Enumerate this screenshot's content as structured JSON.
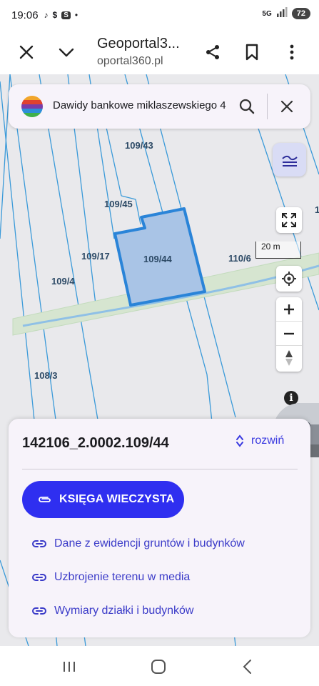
{
  "status_bar": {
    "time": "19:06",
    "notification_icons": [
      "tiktok-icon",
      "dollar-app-icon",
      "s-app-icon",
      "dot-icon"
    ],
    "network": "5G",
    "battery": "72"
  },
  "browser": {
    "title": "Geoportal3...",
    "url": "oportal360.pl"
  },
  "search": {
    "query": "Dawidy bankowe miklaszewskiego 4"
  },
  "map": {
    "scale_label": "20 m",
    "parcels": [
      {
        "label": "109/43"
      },
      {
        "label": "109/45"
      },
      {
        "label": "109/44"
      },
      {
        "label": "109/17"
      },
      {
        "label": "110/6"
      },
      {
        "label": "109/4"
      },
      {
        "label": "108/3"
      },
      {
        "label": "1"
      }
    ],
    "info_icon": "i"
  },
  "card": {
    "parcel_id": "142106_2.0002.109/44",
    "expand_label": "rozwiń",
    "primary_button": "KSIĘGA WIECZYSTA",
    "links": [
      {
        "label": "Dane z ewidencji gruntów i budynków"
      },
      {
        "label": "Uzbrojenie terenu w media"
      },
      {
        "label": "Wymiary działki i budynków"
      }
    ]
  },
  "colors": {
    "accent": "#2f2ff0",
    "link": "#3a3ac8",
    "parcel_fill": "#a9c4e6",
    "parcel_stroke": "#2a84d8",
    "road": "#d6e5d0"
  }
}
